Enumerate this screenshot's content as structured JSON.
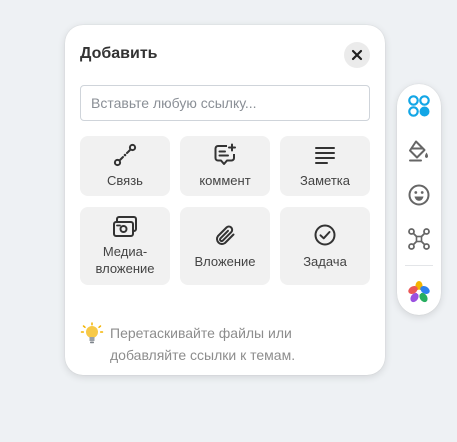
{
  "panel": {
    "title": "Добавить",
    "link_placeholder": "Вставьте любую ссылку...",
    "tiles": [
      {
        "label": "Связь",
        "icon": "connection-icon"
      },
      {
        "label": "коммент",
        "icon": "comment-add-icon"
      },
      {
        "label": "Заметка",
        "icon": "note-lines-icon"
      },
      {
        "label_line1": "Медиа-",
        "label_line2": "вложение",
        "icon": "media-icon"
      },
      {
        "label": "Вложение",
        "icon": "paperclip-icon"
      },
      {
        "label": "Задача",
        "icon": "check-circle-icon"
      }
    ],
    "hint_line1": "Перетаскивайте файлы или",
    "hint_line2": "добавляйте ссылки к темам."
  },
  "side_toolbar": {
    "items": [
      "add-grid-icon",
      "paint-bucket-icon",
      "smiley-icon",
      "relationship-icon",
      "color-flower-icon"
    ]
  },
  "colors": {
    "accent": "#12a6e6",
    "background": "#eef1f4",
    "tile": "#f1f1f1"
  }
}
